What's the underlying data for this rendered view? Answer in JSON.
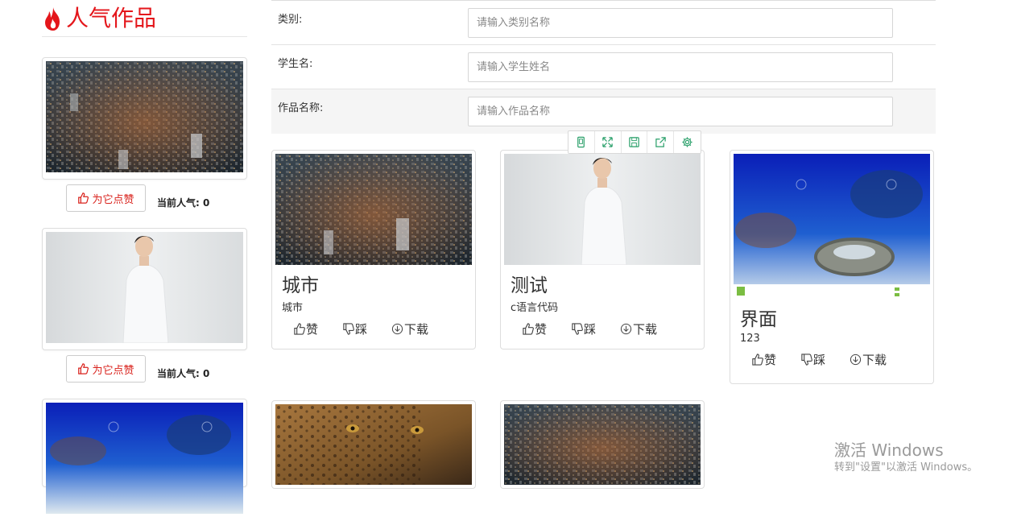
{
  "sidebar": {
    "title": "人气作品",
    "like_label": "为它点赞",
    "popularity_label": "当前人气: 0"
  },
  "filters": {
    "category_label": "类别:",
    "category_placeholder": "请输入类别名称",
    "student_label": "学生名:",
    "student_placeholder": "请输入学生姓名",
    "work_label": "作品名称:",
    "work_placeholder": "请输入作品名称"
  },
  "toolbar": {
    "icons": [
      "mobile-icon",
      "fullscreen-icon",
      "save-icon",
      "export-icon",
      "gear-icon"
    ]
  },
  "works": [
    {
      "title": "城市",
      "desc": "城市",
      "image": "city-night-photo"
    },
    {
      "title": "测试",
      "desc": "c语言代码",
      "image": "man-in-white-photo"
    },
    {
      "title": "界面",
      "desc": "123",
      "image": "underwater-reef-photo"
    }
  ],
  "actions": {
    "like": "赞",
    "dislike": "踩",
    "download": "下载"
  },
  "watermark": {
    "line1": "激活 Windows",
    "line2": "转到\"设置\"以激活 Windows。"
  },
  "colors": {
    "accent_red": "#e4161b",
    "border": "#dddddd"
  }
}
